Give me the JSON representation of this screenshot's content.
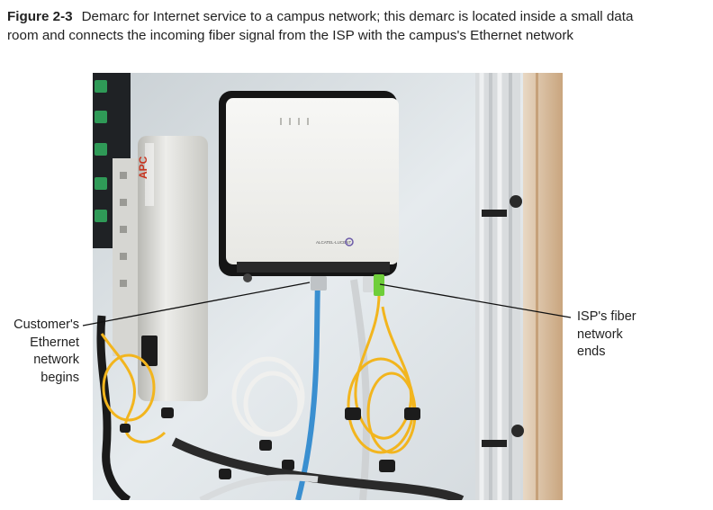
{
  "figure": {
    "label": "Figure 2-3",
    "caption": "Demarc for Internet service to a campus network; this demarc is located inside a small data room and connects the incoming fiber signal from the ISP with the campus's Ethernet network"
  },
  "callouts": {
    "left_line1": "Customer's",
    "left_line2": "Ethernet",
    "left_line3": "network",
    "left_line4": "begins",
    "right_line1": "ISP's fiber",
    "right_line2": "network",
    "right_line3": "ends"
  },
  "device_text": {
    "brand": "APC",
    "modem_label": "ALCATEL-LUCENT"
  },
  "colors": {
    "wall": "#e4e9ec",
    "ethernet_cable": "#3a8fd0",
    "fiber_cable": "#f2b51e",
    "fiber_connector": "#6fce3a",
    "brand_red": "#c8341f"
  }
}
